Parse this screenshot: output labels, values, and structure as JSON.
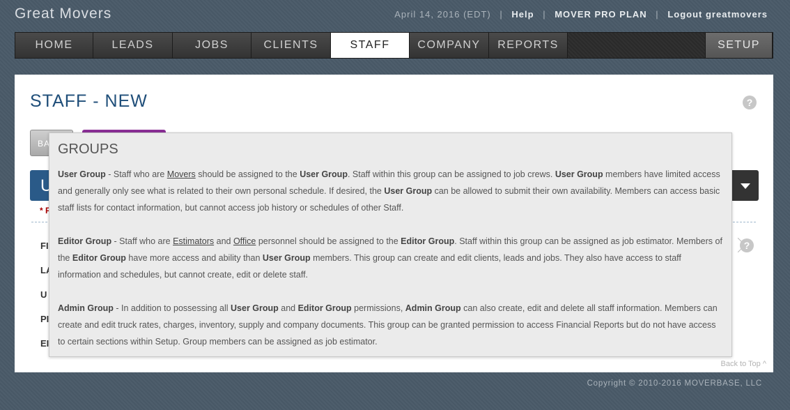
{
  "brand": "Great Movers",
  "topbar": {
    "date": "April 14, 2016 (EDT)",
    "separator": "|",
    "help": "Help",
    "plan": "MOVER PRO PLAN",
    "logout": "Logout greatmovers"
  },
  "nav": {
    "home": "HOME",
    "leads": "LEADS",
    "jobs": "JOBS",
    "clients": "CLIENTS",
    "staff": "STAFF",
    "company": "COMPANY",
    "reports": "REPORTS",
    "setup": "SETUP"
  },
  "page": {
    "title": "STAFF - NEW",
    "help_icon": "?",
    "back_button": "BA",
    "blue_bar_letter": "U",
    "required_mark": "* F",
    "field_labels": [
      "FI",
      "LA",
      "U",
      "PI",
      "EI"
    ],
    "back_to_top": "Back to Top ^"
  },
  "popup": {
    "title": "GROUPS",
    "user_group": {
      "heading": "User Group",
      "t1": " - Staff who are ",
      "movers": "Movers",
      "t2": " should be assigned to the ",
      "bold1": "User Group",
      "t3": ". Staff within this group can be assigned to job crews. ",
      "bold2": "User Group",
      "t4": " members have limited access and generally only see what is related to their own personal schedule. If desired, the ",
      "bold3": "User Group",
      "t5": " can be allowed to submit their own availability. Members can access basic staff lists for contact information, but cannot access job history or schedules of other Staff."
    },
    "editor_group": {
      "heading": "Editor Group",
      "t1": " - Staff who are ",
      "estimators": "Estimators",
      "t2": " and ",
      "office": "Office",
      "t3": " personnel should be assigned to the ",
      "bold1": "Editor Group",
      "t4": ". Staff within this group can be assigned as job estimator. Members of the ",
      "bold2": "Editor Group",
      "t5": " have more access and ability than ",
      "bold3": "User Group",
      "t6": " members. This group can create and edit clients, leads and jobs. They also have access to staff information and schedules, but cannot create, edit or delete staff."
    },
    "admin_group": {
      "heading": "Admin Group",
      "t1": " - In addition to possessing all ",
      "bold1": "User Group",
      "t2": " and ",
      "bold2": "Editor Group",
      "t3": " permissions, ",
      "bold3": "Admin Group",
      "t4": " can also create, edit and delete all staff information. Members can create and edit truck rates, charges, inventory, supply and company documents. This group can be granted permission to access Financial Reports but do not have access to certain sections within Setup. Group members can be assigned as job estimator."
    }
  },
  "footer": "Copyright © 2010-2016 MOVERBASE, LLC"
}
